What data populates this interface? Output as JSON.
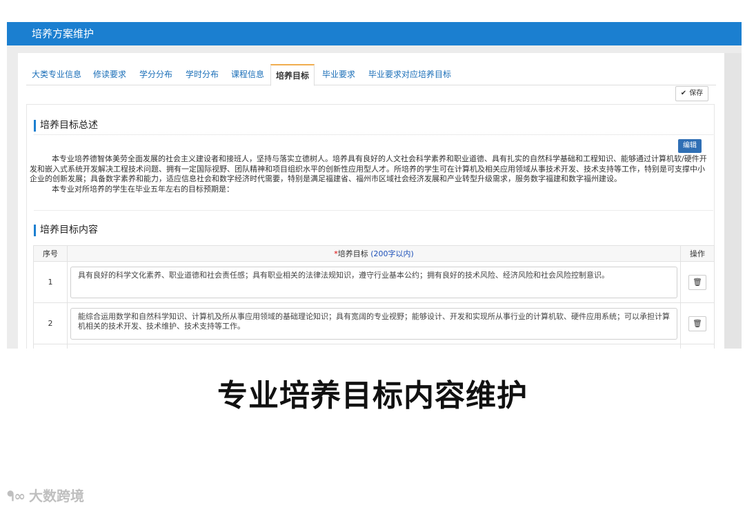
{
  "header": {
    "title": "培养方案维护"
  },
  "tabs": [
    {
      "label": "大类专业信息",
      "active": false
    },
    {
      "label": "修读要求",
      "active": false
    },
    {
      "label": "学分分布",
      "active": false
    },
    {
      "label": "学时分布",
      "active": false
    },
    {
      "label": "课程信息",
      "active": false
    },
    {
      "label": "培养目标",
      "active": true
    },
    {
      "label": "毕业要求",
      "active": false
    },
    {
      "label": "毕业要求对应培养目标",
      "active": false
    }
  ],
  "toolbar": {
    "save_label": "保存"
  },
  "overview": {
    "title": "培养目标总述",
    "edit_label": "编辑",
    "paragraphs": [
      "本专业培养德智体美劳全面发展的社会主义建设者和接班人，坚持与落实立德树人。培养具有良好的人文社会科学素养和职业道德、具有扎实的自然科学基础和工程知识、能够通过计算机软/硬件开发和嵌入式系统开发解决工程技术问题、拥有一定国际视野、团队精神和项目组织水平的创新性应用型人才。所培养的学生可在计算机及相关应用领域从事技术开发、技术支持等工作，特别是可支撑中小企业的创新发展；具备数字素养和能力，适应信息社会和数字经济时代需要，特别是满足福建省、福州市区域社会经济发展和产业转型升级需求，服务数字福建和数字福州建设。",
      "本专业对所培养的学生在毕业五年左右的目标预期是："
    ]
  },
  "goals": {
    "title": "培养目标内容",
    "columns": {
      "no": "序号",
      "goal_required": "*",
      "goal": "培养目标",
      "goal_hint": "(200字以内)",
      "op": "操作"
    },
    "rows": [
      {
        "no": "1",
        "text": "具有良好的科学文化素养、职业道德和社会责任感；具有职业相关的法律法规知识，遵守行业基本公约；拥有良好的技术风险、经济风险和社会风险控制意识。"
      },
      {
        "no": "2",
        "text": "能综合运用数学和自然科学知识、计算机及所从事应用领域的基础理论知识；具有宽阔的专业视野；能够设计、开发和实现所从事行业的计算机软、硬件应用系统；可以承担计算机相关的技术开发、技术维护、技术支持等工作。"
      },
      {
        "no": "",
        "text": ""
      }
    ]
  },
  "caption": "专业培养目标内容维护",
  "watermark": {
    "text": "大数跨境"
  }
}
